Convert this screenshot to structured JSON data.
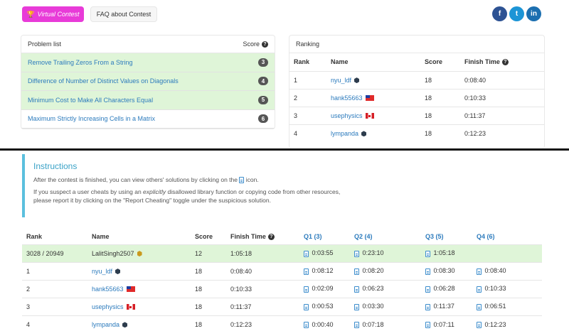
{
  "topbar": {
    "virtual_contest": "Virtual Contest",
    "faq": "FAQ about Contest",
    "social": [
      "f",
      "t",
      "in"
    ]
  },
  "problem_list": {
    "title": "Problem list",
    "score_label": "Score",
    "items": [
      {
        "title": "Remove Trailing Zeros From a String",
        "score": "3",
        "solved": true
      },
      {
        "title": "Difference of Number of Distinct Values on Diagonals",
        "score": "4",
        "solved": true
      },
      {
        "title": "Minimum Cost to Make All Characters Equal",
        "score": "5",
        "solved": true
      },
      {
        "title": "Maximum Strictly Increasing Cells in a Matrix",
        "score": "6",
        "solved": false
      }
    ]
  },
  "ranking_panel": {
    "title": "Ranking",
    "headers": {
      "rank": "Rank",
      "name": "Name",
      "score": "Score",
      "finish": "Finish Time"
    },
    "rows": [
      {
        "rank": "1",
        "name": "nyu_ldf",
        "badge": "hex",
        "score": "18",
        "finish": "0:08:40"
      },
      {
        "rank": "2",
        "name": "hank55663",
        "badge": "flag-tw",
        "score": "18",
        "finish": "0:10:33"
      },
      {
        "rank": "3",
        "name": "usephysics",
        "badge": "flag-ca",
        "score": "18",
        "finish": "0:11:37"
      },
      {
        "rank": "4",
        "name": "lympanda",
        "badge": "hex",
        "score": "18",
        "finish": "0:12:23"
      }
    ]
  },
  "instructions": {
    "title": "Instructions",
    "line1_pre": "After the contest is finished, you can view others' solutions by clicking on the",
    "line1_post": "icon.",
    "line2_pre": "If you suspect a user cheats by using an",
    "line2_em": "explicitly",
    "line2_post": "disallowed library function or copying code from other resources,",
    "line3": "please report it by clicking on the \"Report Cheating\" toggle under the suspicious solution."
  },
  "main_ranking": {
    "headers": {
      "rank": "Rank",
      "name": "Name",
      "score": "Score",
      "finish": "Finish Time",
      "q1": "Q1 (3)",
      "q2": "Q2 (4)",
      "q3": "Q3 (5)",
      "q4": "Q4 (6)"
    },
    "rows": [
      {
        "rank": "3028 / 20949",
        "name": "LalitSingh2507",
        "badge": "hex-gold",
        "score": "12",
        "finish": "1:05:18",
        "q1": "0:03:55",
        "q2": "0:23:10",
        "q3": "1:05:18",
        "q4": "",
        "me": true
      },
      {
        "rank": "1",
        "name": "nyu_ldf",
        "badge": "hex",
        "score": "18",
        "finish": "0:08:40",
        "q1": "0:08:12",
        "q2": "0:08:20",
        "q3": "0:08:30",
        "q4": "0:08:40",
        "me": false
      },
      {
        "rank": "2",
        "name": "hank55663",
        "badge": "flag-tw",
        "score": "18",
        "finish": "0:10:33",
        "q1": "0:02:09",
        "q2": "0:06:23",
        "q3": "0:06:28",
        "q4": "0:10:33",
        "me": false
      },
      {
        "rank": "3",
        "name": "usephysics",
        "badge": "flag-ca",
        "score": "18",
        "finish": "0:11:37",
        "q1": "0:00:53",
        "q2": "0:03:30",
        "q3": "0:11:37",
        "q4": "0:06:51",
        "me": false
      },
      {
        "rank": "4",
        "name": "lympanda",
        "badge": "hex",
        "score": "18",
        "finish": "0:12:23",
        "q1": "0:00:40",
        "q2": "0:07:18",
        "q3": "0:07:11",
        "q4": "0:12:23",
        "me": false
      }
    ]
  }
}
